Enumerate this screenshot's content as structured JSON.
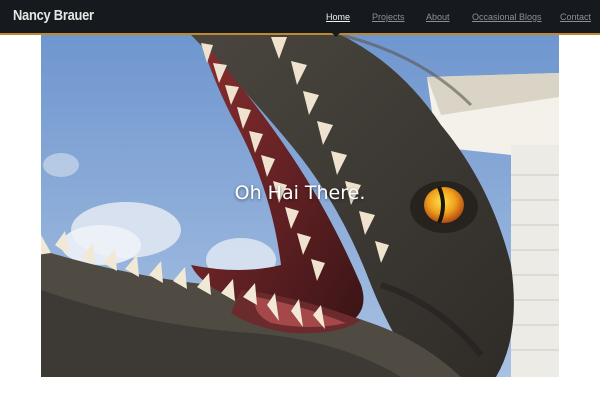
{
  "header": {
    "site_title": "Nancy Brauer",
    "nav": [
      {
        "label": "Home",
        "active": true
      },
      {
        "label": "Projects",
        "active": false
      },
      {
        "label": "About",
        "active": false
      },
      {
        "label": "Occasional Blogs",
        "active": false
      },
      {
        "label": "Contact",
        "active": false
      }
    ]
  },
  "hero": {
    "headline": "Oh Hai There.",
    "image_subject": "dinosaur-statue-open-jaws"
  },
  "colors": {
    "header_bg": "#161a1e",
    "header_accent": "#c08a2c",
    "nav_active": "#f2f2f2",
    "nav_inactive": "#8c8f92"
  }
}
